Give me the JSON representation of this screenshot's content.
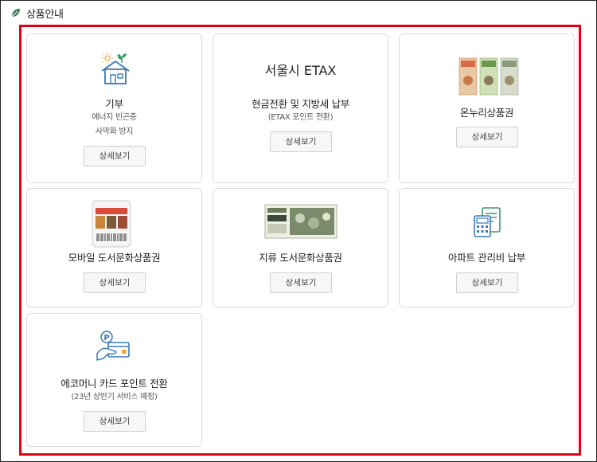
{
  "header": {
    "title": "상품안내",
    "icon": "leaf-icon"
  },
  "colors": {
    "accent": "#e60012",
    "icon_blue": "#3a7ab5",
    "icon_green": "#3a9a6e"
  },
  "cards": [
    {
      "icon": "house-donation-icon",
      "title": "기부",
      "desc": [
        "에너지 빈곤층",
        "사막화 방지"
      ],
      "button": "상세보기"
    },
    {
      "brand": "서울시 ETAX",
      "title": "현금전환 및 지방세 납부",
      "desc": [
        "(ETAX 포인트 전환)"
      ],
      "button": "상세보기"
    },
    {
      "icon": "onnuri-voucher-icon",
      "title": "온누리상품권",
      "button": "상세보기"
    },
    {
      "icon": "mobile-voucher-icon",
      "title": "모바일 도서문화상품권",
      "button": "상세보기"
    },
    {
      "icon": "paper-voucher-icon",
      "title": "지류 도서문화상품권",
      "button": "상세보기"
    },
    {
      "icon": "apartment-fee-icon",
      "title": "아파트 관리비 납부",
      "button": "상세보기"
    },
    {
      "icon": "eco-money-card-icon",
      "title": "에코머니 카드 포인트 전환",
      "desc": [
        "(23년 상반기 서비스 예정)"
      ],
      "button": "상세보기"
    }
  ]
}
